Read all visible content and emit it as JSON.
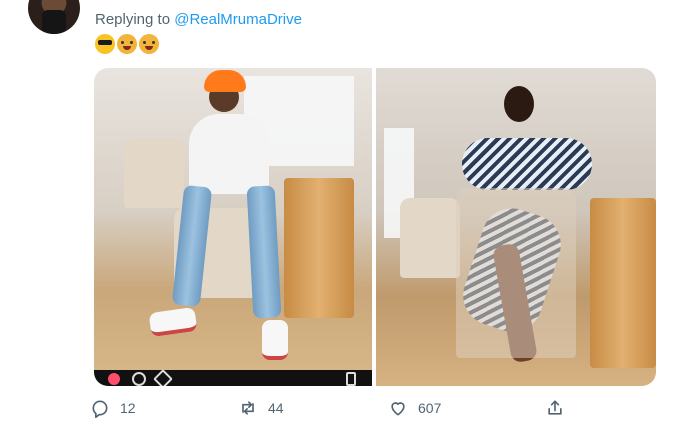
{
  "tweet": {
    "author": "",
    "reply_prefix": "Replying to",
    "reply_handle": "@RealMrumaDrive"
  },
  "actions": {
    "replies": "12",
    "retweets": "44",
    "likes": "607"
  },
  "icons": {
    "reply": "reply-icon",
    "retweet": "retweet-icon",
    "like": "heart-icon",
    "share": "share-icon"
  },
  "colors": {
    "link": "#1d9bf0",
    "muted": "#536471"
  }
}
